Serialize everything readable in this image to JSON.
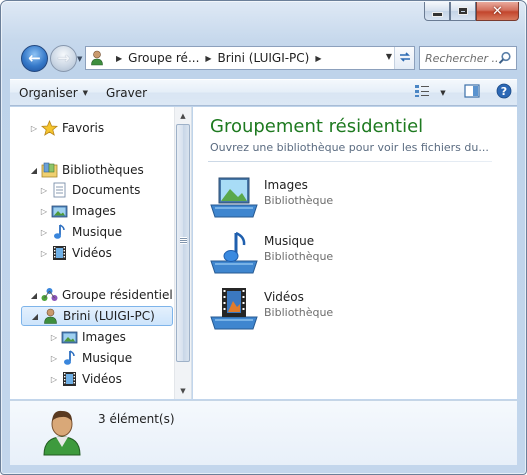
{
  "window": {
    "caption": {
      "minimize_icon": "minimize-icon",
      "maximize_icon": "maximize-icon",
      "close_glyph": "✕"
    }
  },
  "navigation": {
    "back_icon": "back-arrow-icon",
    "forward_icon": "forward-arrow-icon",
    "breadcrumbs": [
      "Groupe ré...",
      "Brini (LUIGI-PC)"
    ],
    "search_placeholder": "Rechercher ..."
  },
  "command_bar": {
    "organize_label": "Organiser",
    "burn_label": "Graver"
  },
  "nav_tree": {
    "favorites": "Favoris",
    "libraries": "Bibliothèques",
    "libraries_children": [
      "Documents",
      "Images",
      "Musique",
      "Vidéos"
    ],
    "homegroup": "Groupe résidentiel",
    "homegroup_user": "Brini (LUIGI-PC)",
    "homegroup_user_children": [
      "Images",
      "Musique",
      "Vidéos"
    ]
  },
  "content": {
    "title": "Groupement résidentiel",
    "subtitle": "Ouvrez une bibliothèque pour voir les fichiers du...",
    "libraries": [
      {
        "name": "Images",
        "type": "Bibliothèque",
        "icon": "pictures-library-icon"
      },
      {
        "name": "Musique",
        "type": "Bibliothèque",
        "icon": "music-library-icon"
      },
      {
        "name": "Vidéos",
        "type": "Bibliothèque",
        "icon": "videos-library-icon"
      }
    ]
  },
  "details": {
    "item_count": "3 élément(s)"
  },
  "colors": {
    "title_green": "#1e7a20",
    "selection_border": "#7eb4ea",
    "frame_blue": "#c6d8ec"
  }
}
